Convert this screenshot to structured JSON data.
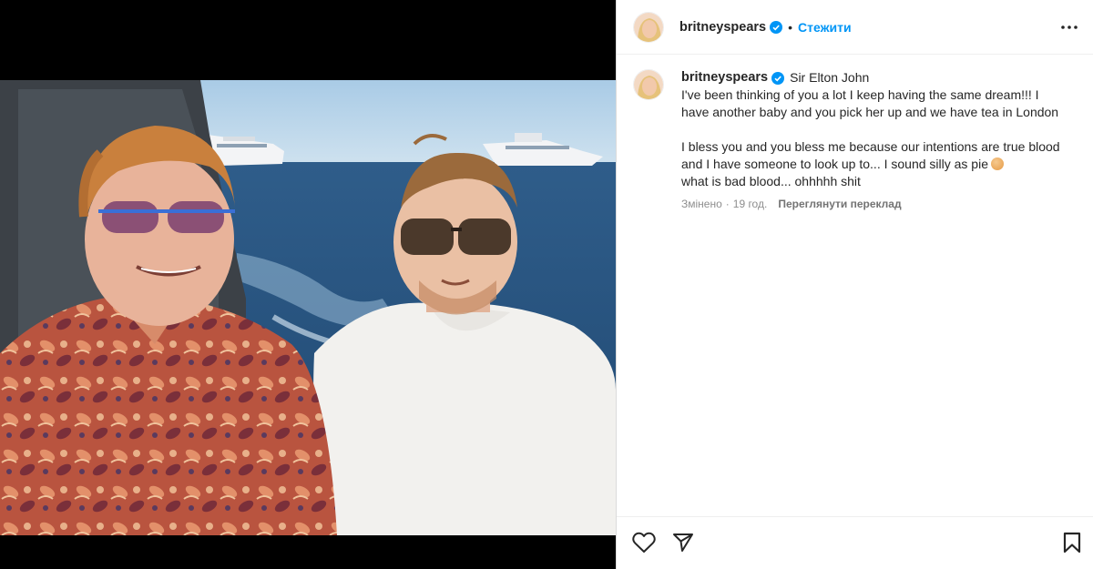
{
  "post": {
    "author": "britneyspears",
    "follow_label": "Стежити",
    "separator": "•"
  },
  "caption": {
    "author": "britneyspears",
    "mention": "Sir Elton John",
    "paragraph1": "I've been thinking of you a lot I keep having the same dream!!! I have another baby and you pick her up and we have tea in London",
    "paragraph2": "I bless you and you bless me because our intentions are true blood and I have someone to look up to... I sound silly as pie",
    "paragraph2_end": "what is bad blood... ohhhhh shit",
    "edited": "Змінено",
    "time": "19 год.",
    "meta_separator": "·",
    "translate_label": "Переглянути переклад"
  },
  "icons": {
    "verified": "verified-badge-icon",
    "more": "more-options-icon",
    "like": "heart-icon",
    "share": "share-icon",
    "save": "bookmark-icon",
    "emoji": "peach-emoji"
  },
  "colors": {
    "accent": "#0095f6",
    "verified": "#0095f6",
    "text": "#262626",
    "muted": "#8e8e8e"
  }
}
